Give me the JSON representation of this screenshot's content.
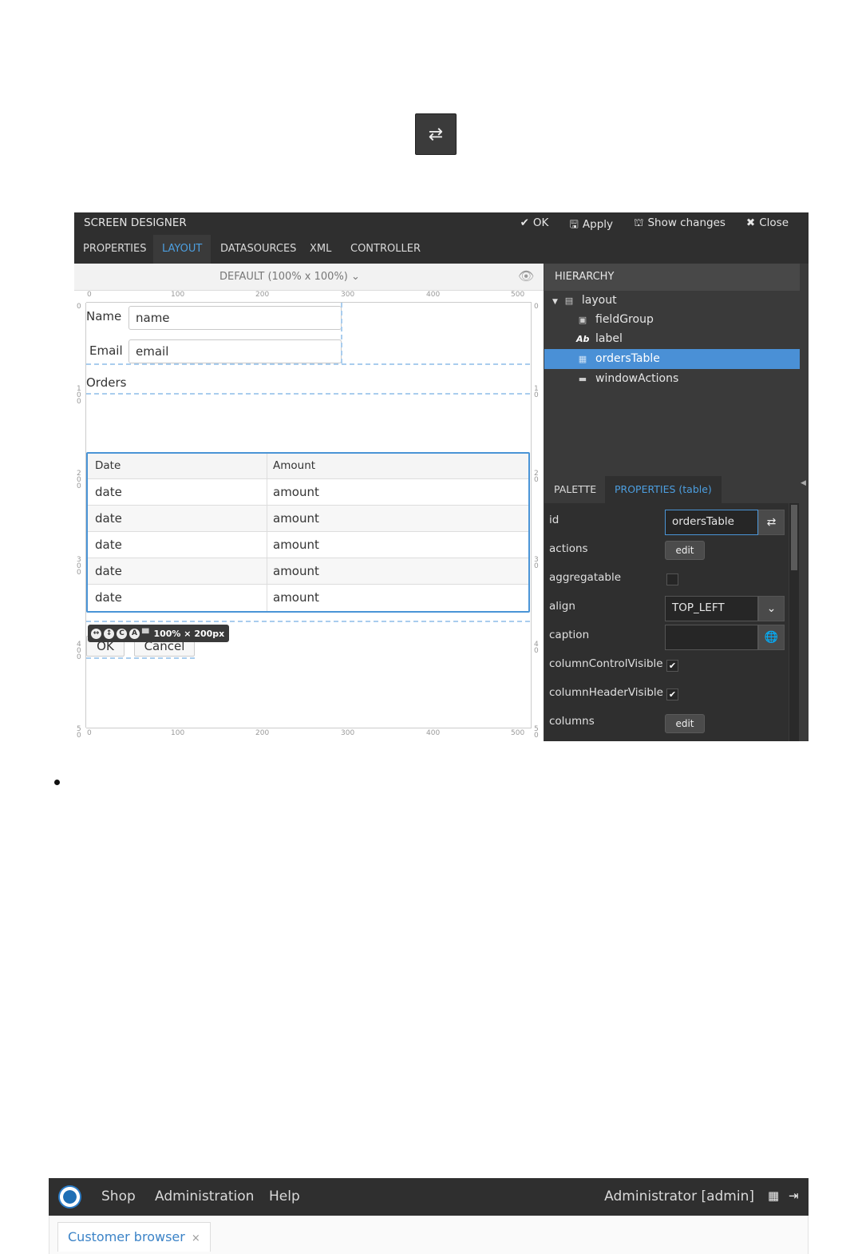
{
  "swap_button": {
    "icon": "swap-arrows-icon",
    "glyph": "⇄"
  },
  "designer": {
    "title": "SCREEN DESIGNER",
    "actions": [
      {
        "icon": "check-icon",
        "glyph": "✔",
        "label": "OK"
      },
      {
        "icon": "save-icon",
        "glyph": "🖫",
        "label": "Apply"
      },
      {
        "icon": "diff-icon",
        "glyph": "⛫",
        "label": "Show changes"
      },
      {
        "icon": "close-icon",
        "glyph": "✖",
        "label": "Close"
      }
    ],
    "tabs": [
      "PROPERTIES",
      "LAYOUT",
      "DATASOURCES",
      "XML",
      "CONTROLLER"
    ],
    "active_tab": "LAYOUT",
    "canvas": {
      "mode": "DEFAULT (100% x 100%)",
      "ruler_top": [
        "0",
        "100",
        "200",
        "300",
        "400",
        "500"
      ],
      "ruler_bottom": [
        "0",
        "100",
        "200",
        "300",
        "400",
        "500"
      ],
      "ruler_left": [
        "0",
        "1 0 0",
        "2 0 0",
        "3 0 0",
        "4 0 0",
        "5 0"
      ],
      "ruler_right": [
        "0",
        "1 0",
        "2 0",
        "3 0",
        "4 0",
        "5 0"
      ],
      "name_label": "Name",
      "name_value": "name",
      "email_label": "Email",
      "email_value": "email",
      "orders_label": "Orders",
      "table": {
        "headers": [
          "Date",
          "Amount"
        ],
        "rows": [
          [
            "date",
            "amount"
          ],
          [
            "date",
            "amount"
          ],
          [
            "date",
            "amount"
          ],
          [
            "date",
            "amount"
          ],
          [
            "date",
            "amount"
          ]
        ]
      },
      "size_badge": "100% × 200px",
      "ok_button": "OK",
      "cancel_button": "Cancel"
    },
    "hierarchy": {
      "title": "HIERARCHY",
      "items": [
        {
          "label": "layout",
          "icon": "layout-icon"
        },
        {
          "label": "fieldGroup",
          "icon": "field-group-icon"
        },
        {
          "label": "label",
          "icon": "label-icon"
        },
        {
          "label": "ordersTable",
          "icon": "table-icon",
          "selected": true
        },
        {
          "label": "windowActions",
          "icon": "window-actions-icon"
        }
      ]
    },
    "panel_tabs": [
      "PALETTE",
      "PROPERTIES (table)"
    ],
    "properties": [
      {
        "name": "id",
        "value": "ordersTable"
      },
      {
        "name": "actions",
        "value": "edit"
      },
      {
        "name": "aggregatable",
        "value": ""
      },
      {
        "name": "align",
        "value": "TOP_LEFT"
      },
      {
        "name": "caption",
        "value": ""
      },
      {
        "name": "columnControlVisible",
        "value": "✔"
      },
      {
        "name": "columnHeaderVisible",
        "value": "✔"
      },
      {
        "name": "columns",
        "value": "edit"
      }
    ]
  },
  "app": {
    "menu": [
      "Shop",
      "Administration",
      "Help"
    ],
    "user": "Administrator [admin]",
    "tab": "Customer browser",
    "tab_close": "×",
    "colors": {
      "bar": "#2f2f2f",
      "accent": "#4a90d6"
    }
  }
}
